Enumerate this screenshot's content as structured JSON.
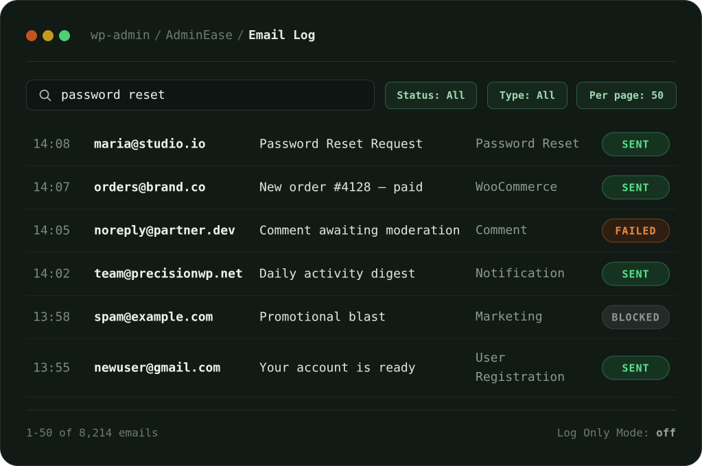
{
  "window": {
    "controls": [
      "close",
      "minimize",
      "maximize"
    ]
  },
  "breadcrumb": {
    "items": [
      "wp-admin",
      "AdminEase",
      "Email Log"
    ],
    "separator": "/"
  },
  "search": {
    "value": "password reset",
    "icon": "search-icon"
  },
  "filters": {
    "status": "Status: All",
    "type": "Type: All",
    "per_page": "Per page: 50"
  },
  "rows": [
    {
      "time": "14:08",
      "to": "maria@studio.io",
      "subject": "Password Reset Request",
      "type": "Password Reset",
      "status": "SENT"
    },
    {
      "time": "14:07",
      "to": "orders@brand.co",
      "subject": "New order #4128 — paid",
      "type": "WooCommerce",
      "status": "SENT"
    },
    {
      "time": "14:05",
      "to": "noreply@partner.dev",
      "subject": "Comment awaiting moderation",
      "type": "Comment",
      "status": "FAILED"
    },
    {
      "time": "14:02",
      "to": "team@precisionwp.net",
      "subject": "Daily activity digest",
      "type": "Notification",
      "status": "SENT"
    },
    {
      "time": "13:58",
      "to": "spam@example.com",
      "subject": "Promotional blast",
      "type": "Marketing",
      "status": "BLOCKED"
    },
    {
      "time": "13:55",
      "to": "newuser@gmail.com",
      "subject": "Your account is ready",
      "type": "User Registration",
      "status": "SENT"
    }
  ],
  "footer": {
    "range": "1-50 of 8,214 emails",
    "log_only_label": "Log Only Mode:",
    "log_only_value": "off"
  },
  "colors": {
    "background": "#121a16",
    "sent": "#5be38a",
    "failed": "#f08a3a",
    "blocked": "#8e9892",
    "accent": "#9ed8b0"
  }
}
